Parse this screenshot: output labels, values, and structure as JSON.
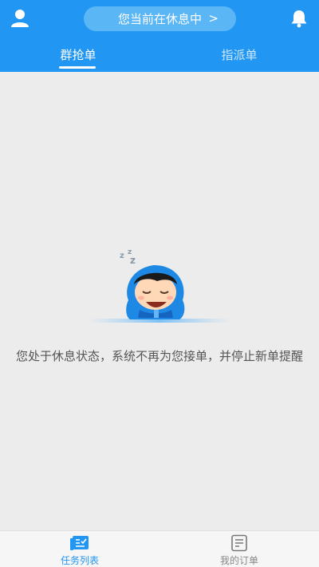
{
  "header": {
    "status_text": "您当前在休息中",
    "status_chevron": ">",
    "avatar_icon": "user-icon",
    "bell_icon": "bell-icon",
    "tabs": [
      {
        "label": "群抢单",
        "active": true
      },
      {
        "label": "指派单",
        "active": false
      }
    ]
  },
  "main": {
    "message": "您处于休息状态，系统不再为您接单，并停止新单提醒",
    "illustration_icon": "sleeping-mascot",
    "sleep_letters": "zzz"
  },
  "bottom_nav": {
    "items": [
      {
        "label": "任务列表",
        "icon": "task-list-icon",
        "active": true
      },
      {
        "label": "我的订单",
        "icon": "order-icon",
        "active": false
      }
    ]
  },
  "colors": {
    "primary": "#2196f3",
    "pill": "#5bb6f6",
    "background": "#ececec",
    "text": "#555555"
  }
}
